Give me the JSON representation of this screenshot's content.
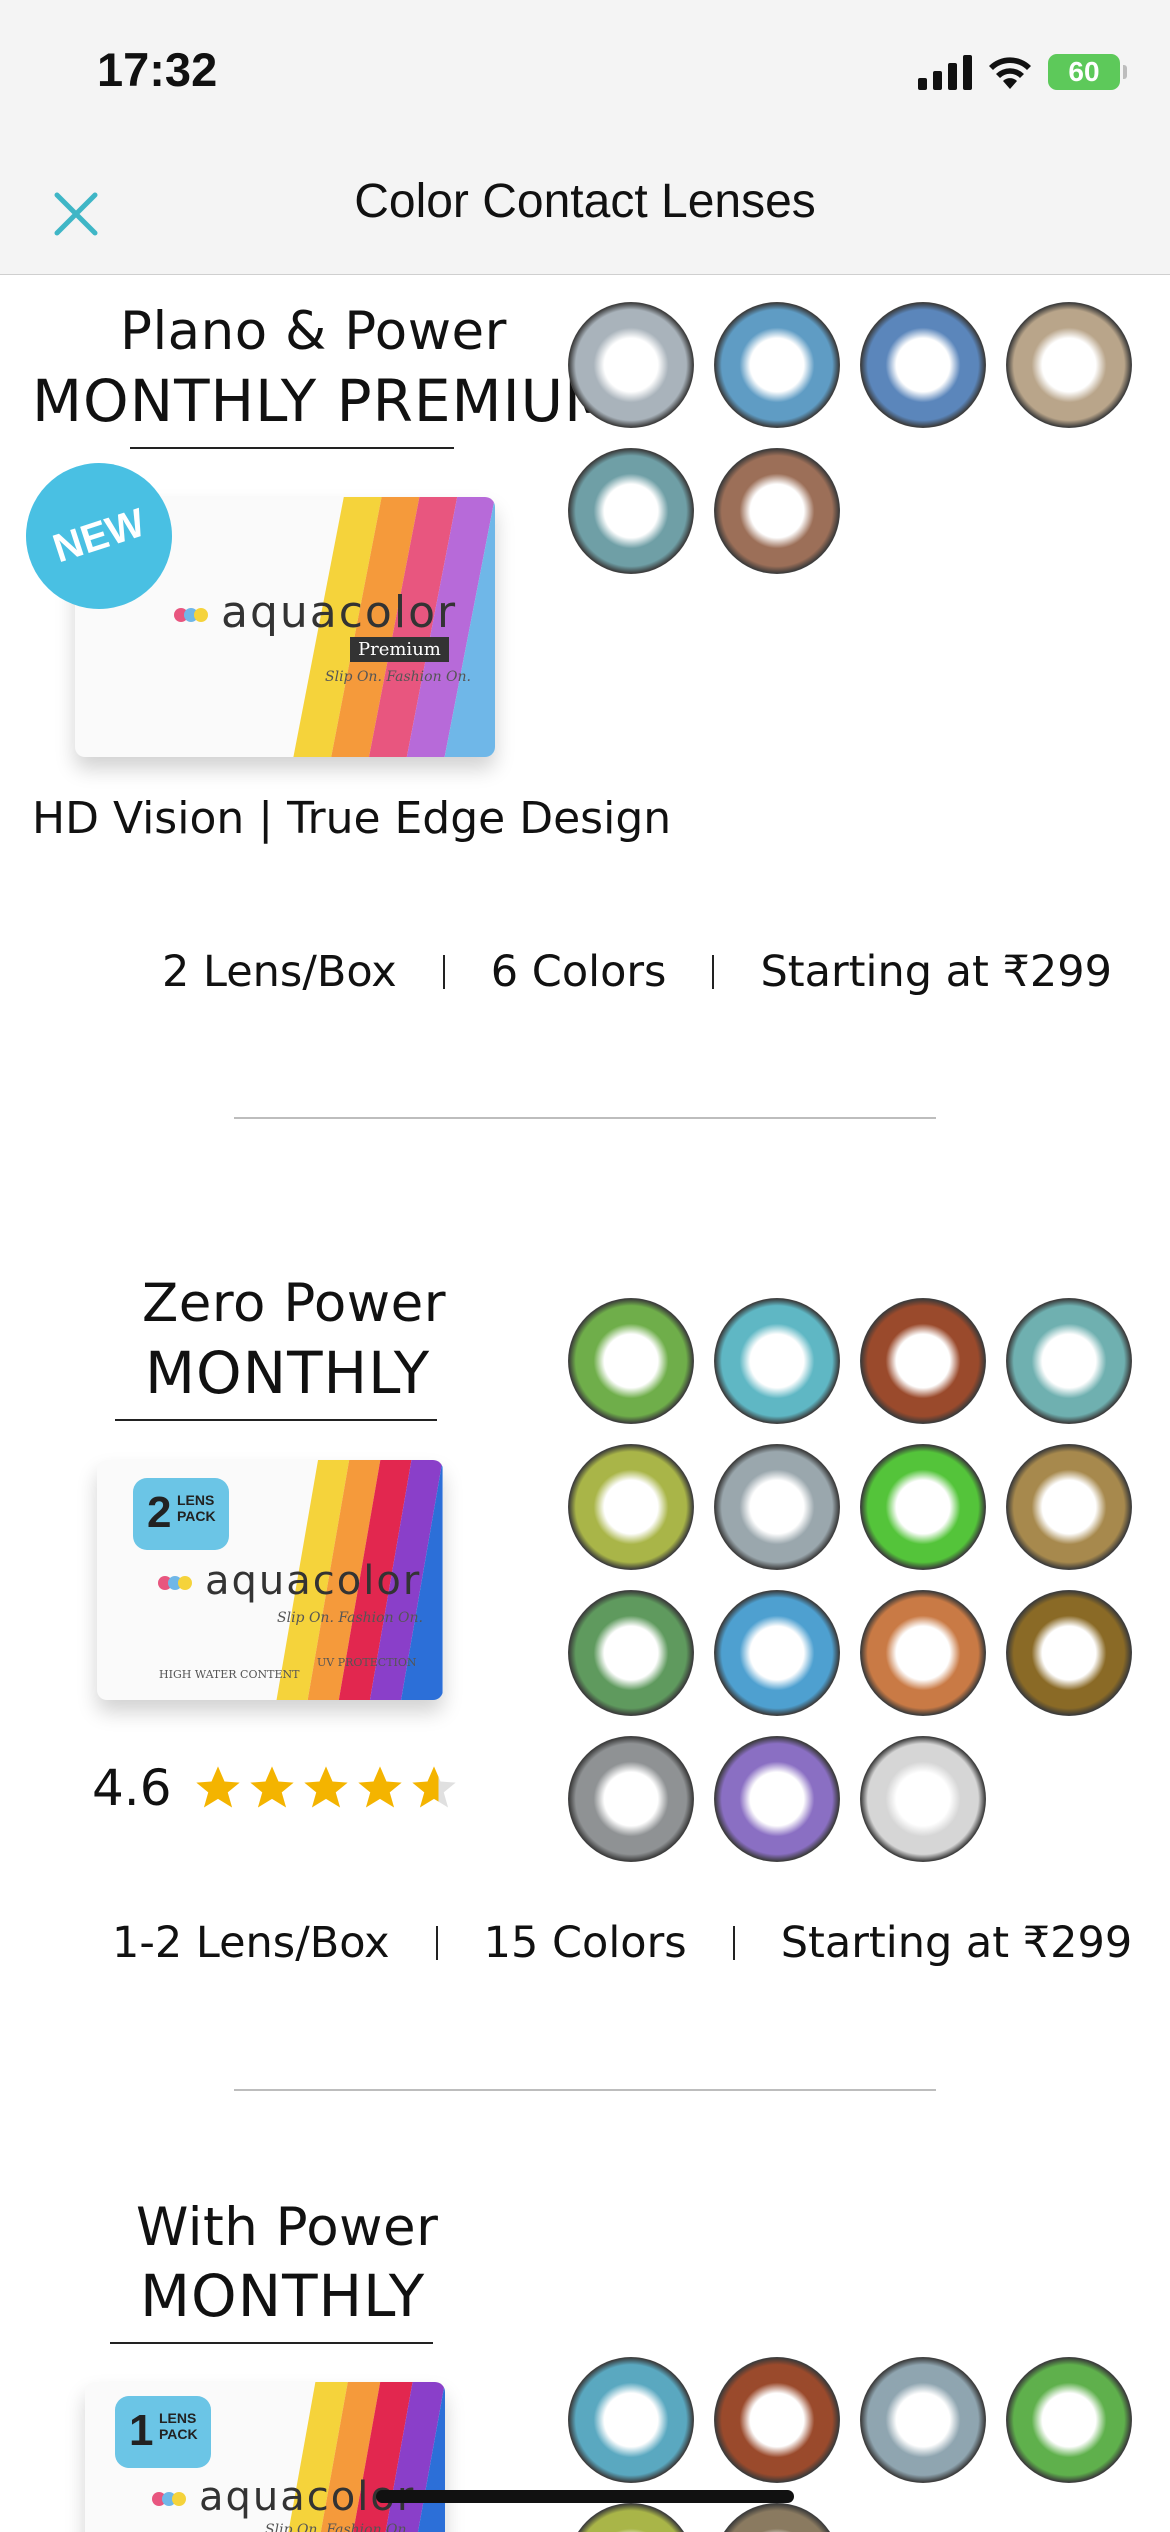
{
  "status_bar": {
    "time": "17:32",
    "battery": "60",
    "icons": [
      "signal-icon",
      "wifi-icon",
      "battery-icon"
    ]
  },
  "nav": {
    "title": "Color Contact Lenses",
    "close_icon": "close-icon"
  },
  "colors": {
    "accent": "#3fb6c6",
    "new_badge": "#49c0e3",
    "star": "#f4b400"
  },
  "sections": [
    {
      "heading_small": "Plano & Power",
      "heading_big": "MONTHLY PREMIUM",
      "badge": "NEW",
      "box": {
        "brand": "aquacolor",
        "sub": "Premium",
        "tagline": "Slip On. Fashion On."
      },
      "feature": "HD Vision | True Edge Design",
      "specs": [
        "2 Lens/Box",
        "6 Colors",
        "Starting at ₹299"
      ],
      "lens_colors": [
        "#a9b3bb",
        "#5f9cc4",
        "#5b86bb",
        "#b9a58a",
        "#6f9fa6",
        "#9c6f58"
      ]
    },
    {
      "heading_small": "Zero Power",
      "heading_big": "MONTHLY",
      "box": {
        "brand": "aquacolor",
        "pack_num": "2",
        "pack_text": "LENS PACK",
        "tagline": "Slip On. Fashion On.",
        "footer_left": "HIGH WATER CONTENT",
        "footer_right": "UV PROTECTION"
      },
      "rating": "4.6",
      "stars": 4.6,
      "specs": [
        "1-2 Lens/Box",
        "15 Colors",
        "Starting at ₹299"
      ],
      "lens_colors": [
        "#6fae4a",
        "#5fb7c4",
        "#9a4a2c",
        "#6fb0b0",
        "#a9b548",
        "#9aa7ad",
        "#54c43a",
        "#a7894d",
        "#5f9a5e",
        "#4ea0d0",
        "#c97a45",
        "#8a6a26",
        "#8f9294",
        "#8a6fc3",
        "#d6d6d6"
      ]
    },
    {
      "heading_small": "With Power",
      "heading_big": "MONTHLY",
      "box": {
        "brand": "aquacolor",
        "pack_num": "1",
        "pack_text": "LENS PACK",
        "tagline": "Slip On. Fashion On."
      },
      "lens_colors": [
        "#5aa8c0",
        "#9a4a2c",
        "#8fa5b0",
        "#5fb04c",
        "#a9b548",
        "#8a7a60"
      ]
    }
  ]
}
